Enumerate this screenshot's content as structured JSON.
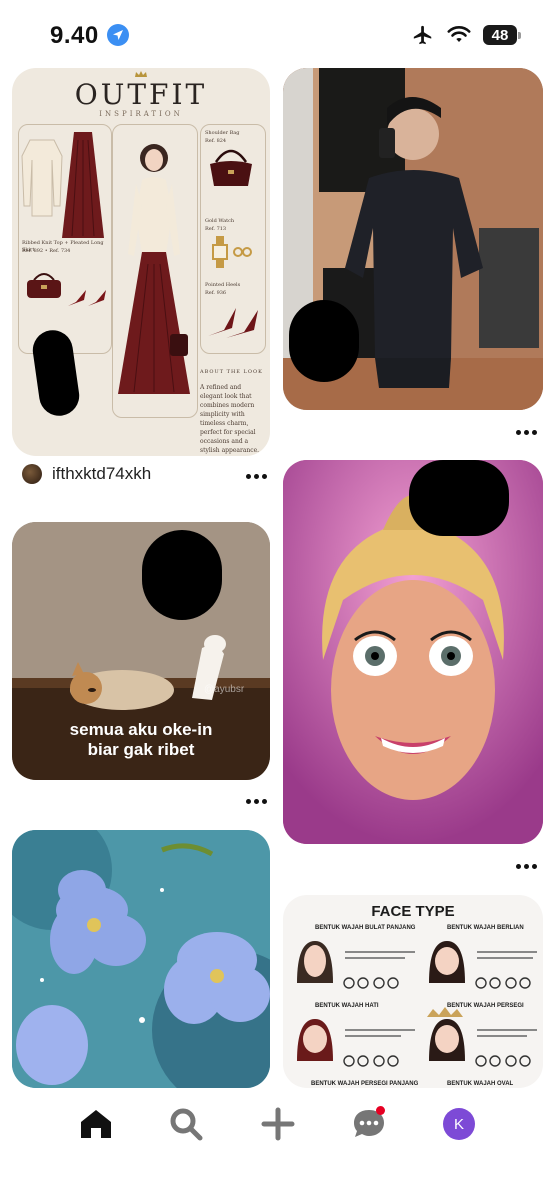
{
  "status_bar": {
    "time": "9.40",
    "battery": "48"
  },
  "pins": {
    "outfit": {
      "title": "OUTFIT",
      "subtitle": "INSPIRATION",
      "item_top_skirt": "Ribbed Knit Top + Pleated Long Skirt",
      "item_top_skirt_ref": "Ref. 892 • Ref. 734",
      "shoulder_bag": "Shoulder Bag",
      "shoulder_bag_ref": "Ref. 824",
      "gold_watch": "Gold Watch",
      "gold_watch_ref": "Ref. 713",
      "pointed_heels": "Pointed Heels",
      "pointed_heels_ref": "Ref. 936",
      "about_heading": "ABOUT THE LOOK",
      "about_text": "A refined and elegant look that combines modern simplicity with timeless charm, perfect for special occasions and a stylish appearance."
    },
    "creator": {
      "name": "ifthxktd74xkh"
    },
    "cat": {
      "caption_line1": "semua aku oke-in",
      "caption_line2": "biar gak ribet",
      "watermark": "@ayubsr"
    },
    "face": {
      "title": "FACE TYPE",
      "labels": [
        "BENTUK WAJAH BULAT PANJANG",
        "BENTUK WAJAH BERLIAN",
        "BENTUK WAJAH HATI",
        "BENTUK WAJAH PERSEGI",
        "BENTUK WAJAH PERSEGI PANJANG",
        "BENTUK WAJAH OVAL"
      ]
    }
  },
  "nav": {
    "profile_initial": "K"
  },
  "colors": {
    "notification_dot": "#e60023",
    "avatar": "#7d4ad6",
    "location_icon": "#3b8ff3"
  }
}
